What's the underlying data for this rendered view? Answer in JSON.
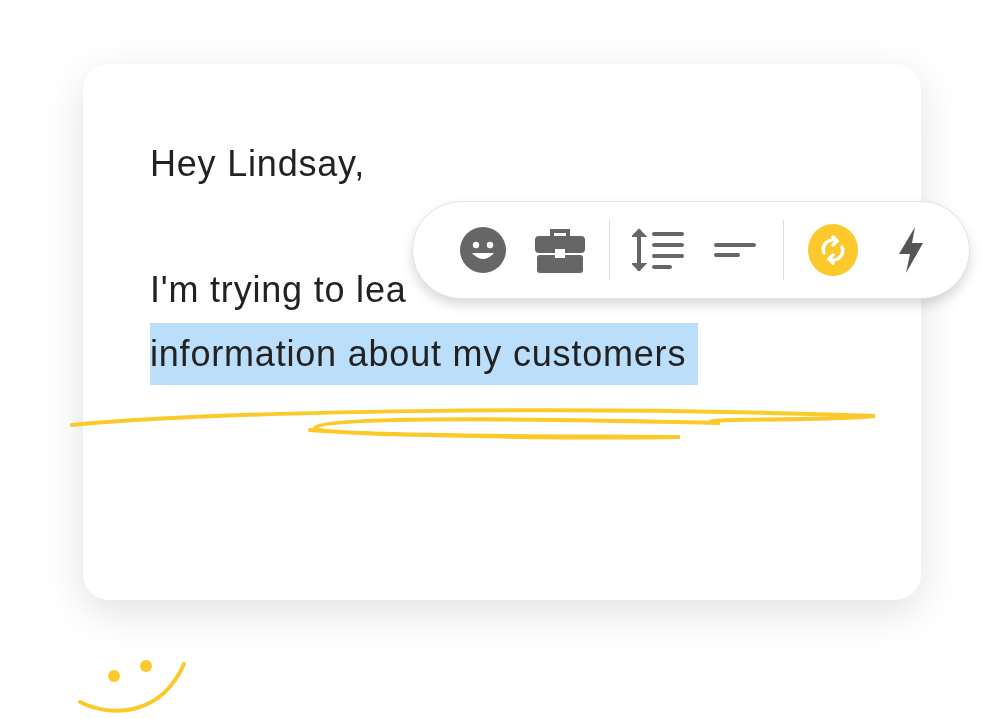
{
  "message": {
    "greeting": "Hey Lindsay,",
    "body": "I'm trying to lea",
    "selected_text": "information about my customers"
  },
  "toolbar": {
    "groups": [
      [
        {
          "kind": "emoji",
          "selected": false
        },
        {
          "kind": "briefcase",
          "selected": false
        }
      ],
      [
        {
          "kind": "line-spacing",
          "selected": false
        },
        {
          "kind": "short-text",
          "selected": false
        }
      ],
      [
        {
          "kind": "sync",
          "selected": true
        },
        {
          "kind": "bolt",
          "selected": false
        }
      ]
    ]
  }
}
